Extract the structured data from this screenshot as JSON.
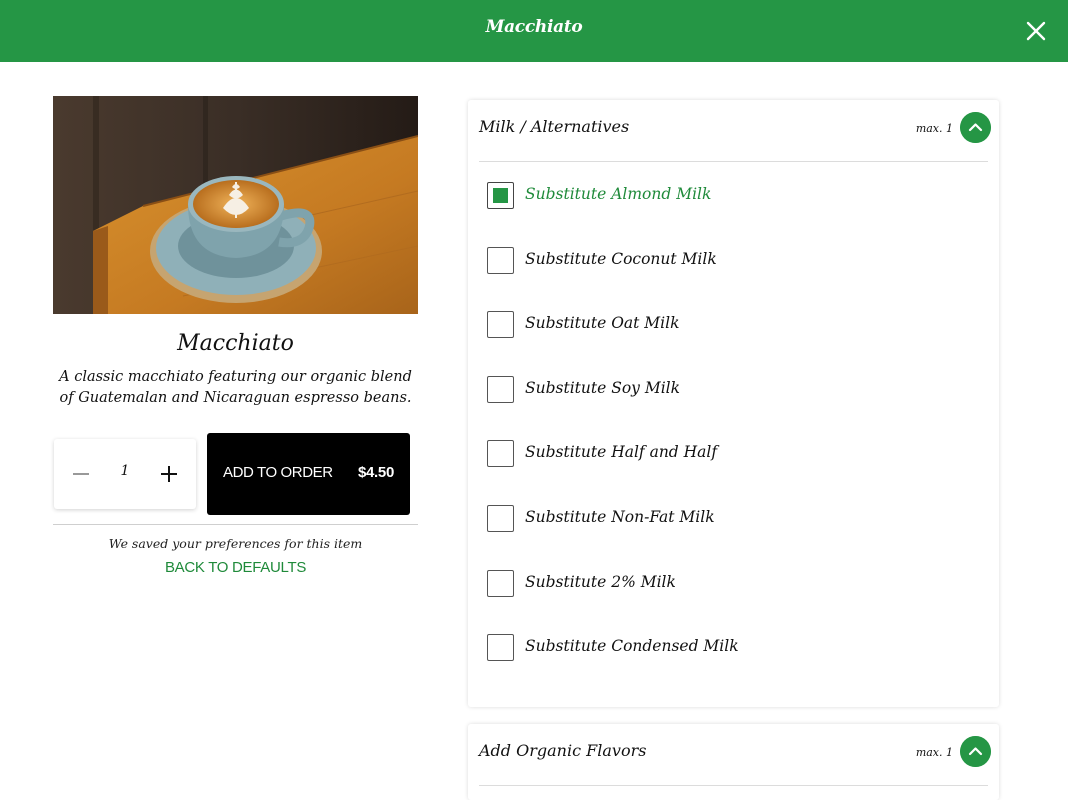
{
  "header": {
    "title": "Macchiato"
  },
  "product": {
    "name": "Macchiato",
    "description": "A classic macchiato featuring our organic blend of Guatemalan and Nicaraguan espresso beans."
  },
  "order": {
    "quantity": "1",
    "add_label": "ADD TO ORDER",
    "price": "$4.50",
    "saved_note": "We saved your preferences for this item",
    "back_defaults": "BACK TO DEFAULTS"
  },
  "groups": [
    {
      "title": "Milk / Alternatives",
      "max": "max. 1",
      "options": [
        {
          "label": "Substitute Almond Milk",
          "checked": true
        },
        {
          "label": "Substitute Coconut Milk",
          "checked": false
        },
        {
          "label": "Substitute Oat Milk",
          "checked": false
        },
        {
          "label": "Substitute Soy Milk",
          "checked": false
        },
        {
          "label": "Substitute Half and Half",
          "checked": false
        },
        {
          "label": "Substitute Non-Fat Milk",
          "checked": false
        },
        {
          "label": "Substitute 2% Milk",
          "checked": false
        },
        {
          "label": "Substitute Condensed Milk",
          "checked": false
        }
      ]
    },
    {
      "title": "Add Organic Flavors",
      "max": "max. 1"
    }
  ],
  "colors": {
    "brand_green": "#259645",
    "link_green": "#1f8a3a",
    "button_black": "#000000"
  },
  "icons": {
    "close": "close-icon",
    "collapse": "chevron-up-icon",
    "minus": "minus-icon",
    "plus": "plus-icon"
  }
}
